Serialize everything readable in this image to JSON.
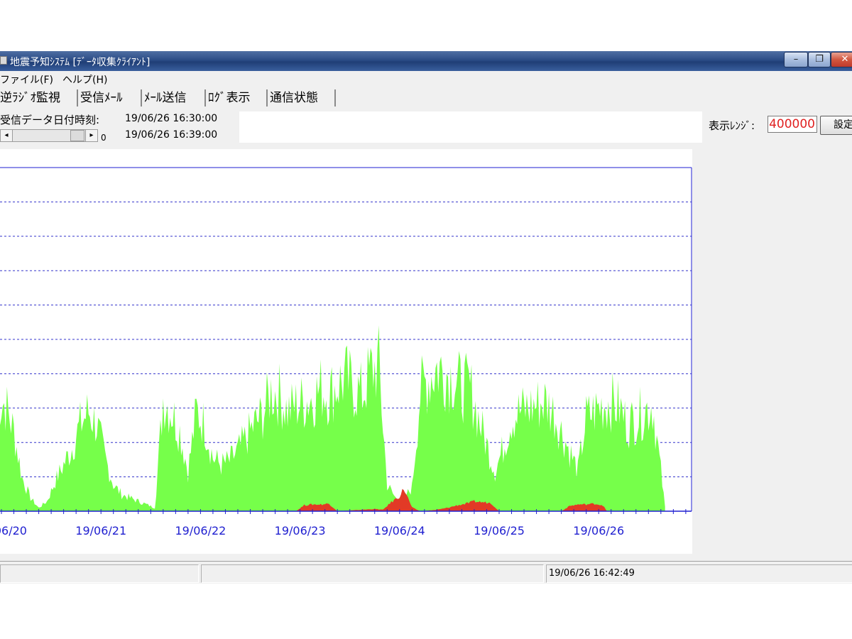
{
  "window": {
    "title": "地震予知ｼｽﾃﾑ [ﾃﾞｰﾀ収集ｸﾗｲｱﾝﾄ]",
    "minimize_glyph": "–",
    "maximize_glyph": "❐",
    "close_glyph": "✕"
  },
  "menu": {
    "file": "ファイル(F)",
    "help": "ヘルプ(H)"
  },
  "tabs": [
    {
      "label": "逆ﾗｼﾞｵ監視"
    },
    {
      "label": "受信ﾒｰﾙ"
    },
    {
      "label": "ﾒｰﾙ送信"
    },
    {
      "label": "ﾛｸﾞ表示"
    },
    {
      "label": "通信状態"
    }
  ],
  "received": {
    "label": "受信データ日付時刻:",
    "from": "19/06/26 16:30:00",
    "to": "19/06/26 16:39:00"
  },
  "scroll": {
    "left_glyph": "◂",
    "right_glyph": "▸",
    "value": "0"
  },
  "range": {
    "label": "表示ﾚﾝｼﾞ:",
    "value": "400000",
    "set_button": "設定"
  },
  "status": {
    "datetime": "19/06/26 16:42:49"
  },
  "colors": {
    "green_series": "#76ff4a",
    "red_series": "#e23a26",
    "axis": "#1f1fd0",
    "gridline": "#3333cc"
  },
  "chart_data": {
    "type": "area",
    "title": "",
    "xlabel": "",
    "ylabel": "",
    "x_tick_labels": [
      "19/06/20",
      "19/06/21",
      "19/06/22",
      "19/06/23",
      "19/06/24",
      "19/06/25",
      "19/06/26"
    ],
    "x_range": [
      "19/06/19 23:00",
      "19/06/26 22:00"
    ],
    "ylim": [
      0,
      400000
    ],
    "y_gridlines": 9,
    "grid": true,
    "series": [
      {
        "color": "green",
        "x": [
          "19/06/19 23:00",
          "19/06/20 01:00",
          "19/06/20 03:00",
          "19/06/20 05:00",
          "19/06/20 07:00",
          "19/06/20 09:00",
          "19/06/20 11:00",
          "19/06/20 13:00",
          "19/06/20 15:00",
          "19/06/20 17:00",
          "19/06/20 19:00",
          "19/06/20 21:00",
          "19/06/20 23:00",
          "19/06/21 01:00",
          "19/06/21 03:00",
          "19/06/21 05:00",
          "19/06/21 07:00",
          "19/06/21 09:00",
          "19/06/21 11:00",
          "19/06/21 13:00",
          "19/06/21 15:00",
          "19/06/21 17:00",
          "19/06/21 19:00",
          "19/06/21 21:00",
          "19/06/21 23:00",
          "19/06/22 01:00",
          "19/06/22 03:00",
          "19/06/22 05:00",
          "19/06/22 07:00",
          "19/06/22 09:00",
          "19/06/22 11:00",
          "19/06/22 13:00",
          "19/06/22 15:00",
          "19/06/22 17:00",
          "19/06/22 19:00",
          "19/06/22 21:00",
          "19/06/22 23:00",
          "19/06/23 01:00",
          "19/06/23 03:00",
          "19/06/23 05:00",
          "19/06/23 07:00",
          "19/06/23 09:00",
          "19/06/23 11:00",
          "19/06/23 13:00",
          "19/06/23 15:00",
          "19/06/23 17:00",
          "19/06/23 19:00",
          "19/06/23 21:00",
          "19/06/23 23:00",
          "19/06/24 01:00",
          "19/06/24 03:00",
          "19/06/24 05:00",
          "19/06/24 07:00",
          "19/06/24 09:00",
          "19/06/24 11:00",
          "19/06/24 13:00",
          "19/06/24 15:00",
          "19/06/24 17:00",
          "19/06/24 19:00",
          "19/06/24 21:00",
          "19/06/24 23:00",
          "19/06/25 01:00",
          "19/06/25 03:00",
          "19/06/25 05:00",
          "19/06/25 07:00",
          "19/06/25 09:00",
          "19/06/25 11:00",
          "19/06/25 13:00",
          "19/06/25 15:00",
          "19/06/25 17:00",
          "19/06/25 19:00",
          "19/06/25 21:00",
          "19/06/25 23:00",
          "19/06/26 01:00",
          "19/06/26 03:00",
          "19/06/26 05:00",
          "19/06/26 07:00",
          "19/06/26 09:00",
          "19/06/26 11:00",
          "19/06/26 13:00",
          "19/06/26 15:00",
          "19/06/26 16:00"
        ],
        "values": [
          170000,
          160000,
          120000,
          50000,
          20000,
          5000,
          15000,
          45000,
          70000,
          95000,
          130000,
          150000,
          130000,
          80000,
          40000,
          25000,
          20000,
          15000,
          10000,
          5000,
          170000,
          150000,
          120000,
          60000,
          150000,
          130000,
          80000,
          70000,
          75000,
          90000,
          110000,
          130000,
          145000,
          180000,
          175000,
          150000,
          160000,
          165000,
          170000,
          185000,
          175000,
          190000,
          200000,
          185000,
          175000,
          210000,
          220000,
          40000,
          20000,
          20000,
          35000,
          180000,
          200000,
          215000,
          210000,
          200000,
          185000,
          185000,
          140000,
          100000,
          60000,
          95000,
          140000,
          150000,
          155000,
          160000,
          165000,
          150000,
          120000,
          90000,
          60000,
          140000,
          150000,
          160000,
          165000,
          155000,
          130000,
          140000,
          150000,
          160000,
          60000,
          5000
        ]
      },
      {
        "color": "red",
        "x": [
          "19/06/22 23:00",
          "19/06/23 01:00",
          "19/06/23 03:00",
          "19/06/23 05:00",
          "19/06/23 07:00",
          "19/06/23 09:00",
          "19/06/23 15:00",
          "19/06/23 18:00",
          "19/06/23 20:00",
          "19/06/23 22:00",
          "19/06/24 00:00",
          "19/06/24 01:00",
          "19/06/24 03:00",
          "19/06/24 05:00",
          "19/06/24 09:00",
          "19/06/24 12:00",
          "19/06/24 14:00",
          "19/06/24 16:00",
          "19/06/24 18:00",
          "19/06/24 20:00",
          "19/06/24 22:00",
          "19/06/25 00:00",
          "19/06/25 15:00",
          "19/06/25 17:00",
          "19/06/25 19:00",
          "19/06/25 21:00",
          "19/06/25 23:00",
          "19/06/26 01:00",
          "19/06/26 02:00"
        ],
        "values": [
          0,
          8000,
          9000,
          9000,
          10000,
          0,
          2000,
          3000,
          2000,
          12000,
          20000,
          30000,
          5000,
          0,
          2000,
          5000,
          8000,
          10000,
          13000,
          12000,
          11000,
          0,
          0,
          7000,
          9000,
          9000,
          10000,
          8000,
          0
        ]
      }
    ]
  }
}
